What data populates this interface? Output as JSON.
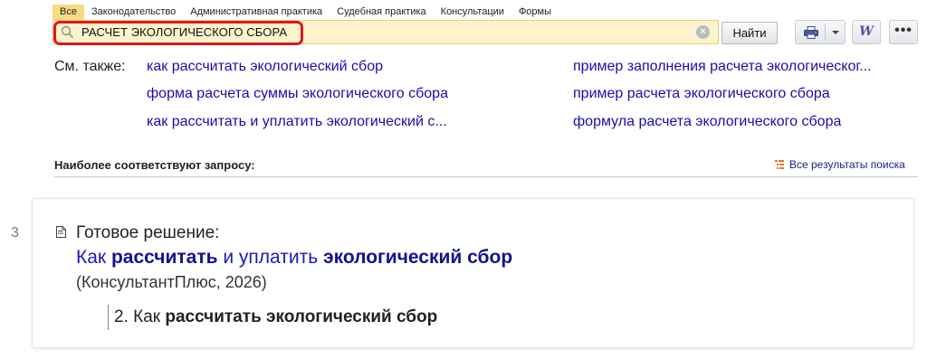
{
  "tabs": [
    {
      "label": "Все",
      "active": true
    },
    {
      "label": "Законодательство",
      "active": false
    },
    {
      "label": "Административная практика",
      "active": false
    },
    {
      "label": "Судебная практика",
      "active": false
    },
    {
      "label": "Консультации",
      "active": false
    },
    {
      "label": "Формы",
      "active": false
    }
  ],
  "search": {
    "value": "РАСЧЕТ ЭКОЛОГИЧЕСКОГО СБОРА",
    "find_label": "Найти",
    "clear_icon": "close-icon"
  },
  "toolbar": {
    "print_icon": "printer-icon",
    "word_icon": "word-export-icon",
    "word_glyph": "W",
    "more_glyph": "•••"
  },
  "see_also": {
    "label": "См. также:",
    "left": [
      "как рассчитать экологический сбор",
      "форма расчета суммы экологического сбора",
      "как рассчитать и уплатить экологический с..."
    ],
    "right": [
      "пример заполнения расчета экологическог...",
      "пример расчета экологического сбора",
      "формула расчета экологического сбора"
    ]
  },
  "best_match": {
    "label": "Наиболее соответствуют запросу:",
    "all_results": "Все результаты поиска"
  },
  "result": {
    "number": "3",
    "type": "Готовое решение:",
    "title_parts": [
      "Как ",
      "рассчитать",
      " и уплатить ",
      "экологический сбор"
    ],
    "source": "(КонсультантПлюс, 2026)",
    "sub_parts": [
      "2. Как ",
      "рассчитать экологический сбор"
    ]
  },
  "colors": {
    "accent_tab": "#f6dc84",
    "search_bg": "#fdf3cd",
    "highlight": "#e0161d",
    "link": "#1a0dab"
  }
}
